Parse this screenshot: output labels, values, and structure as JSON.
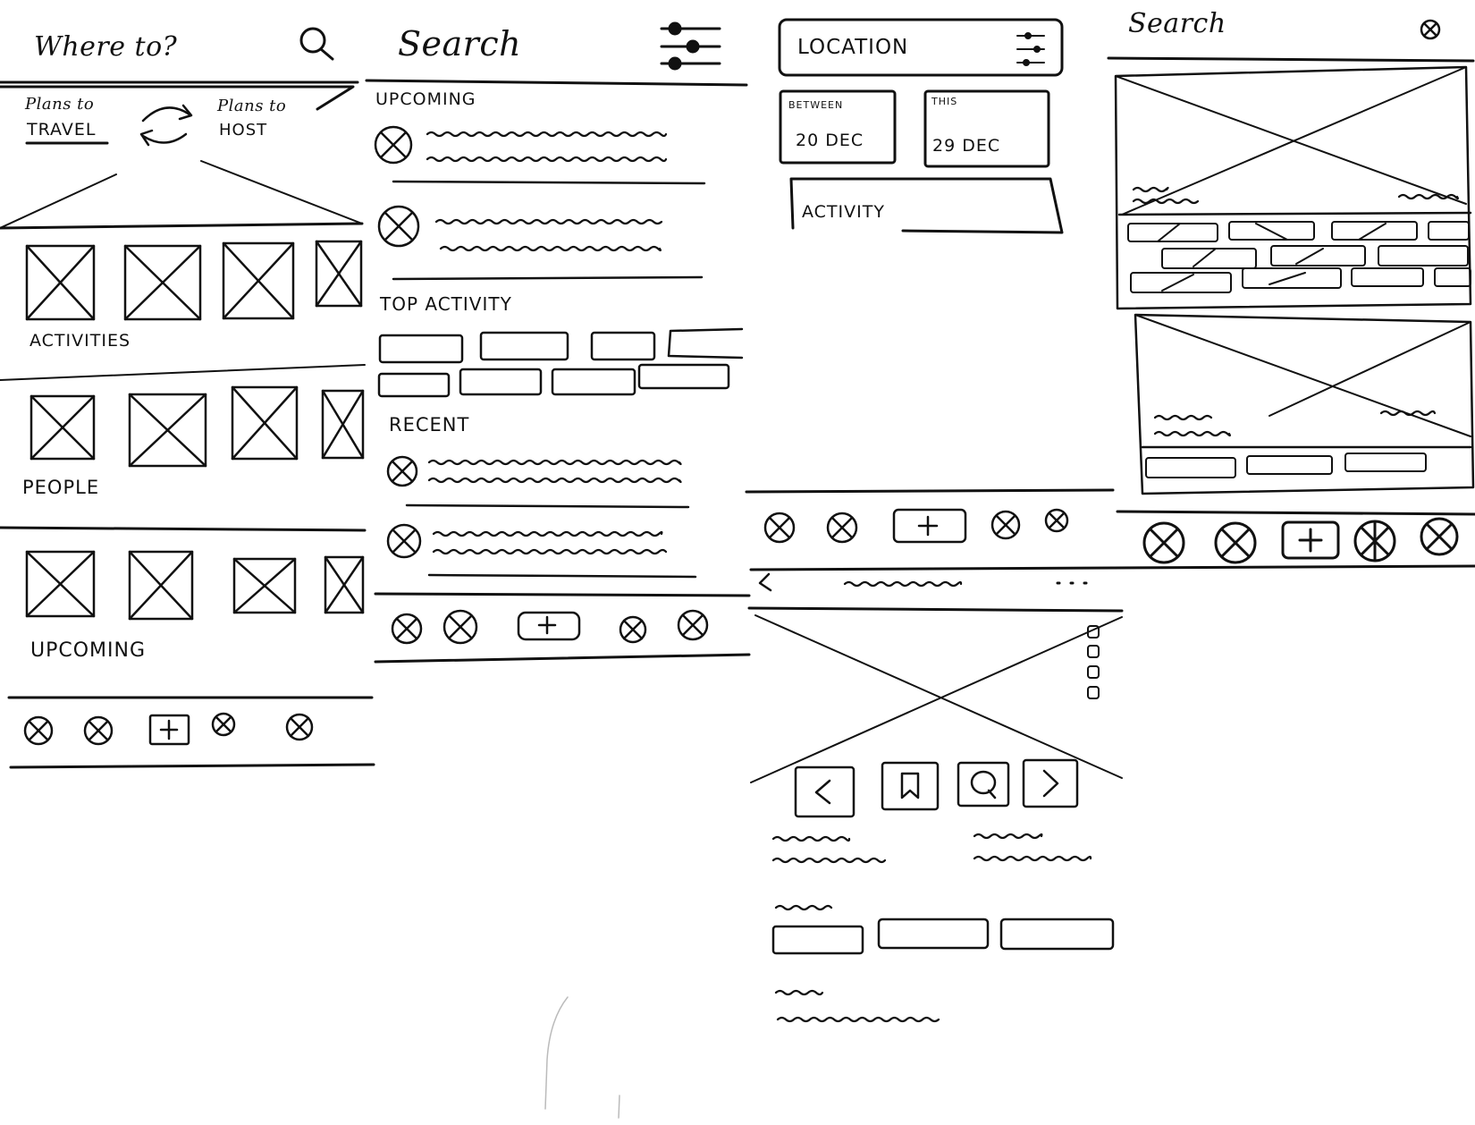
{
  "screens": [
    {
      "id": "home",
      "header": {
        "title": "Where to?",
        "search_icon": "search-icon"
      },
      "toggle": {
        "left": "Plans to",
        "left_emph": "TRAVEL",
        "right": "Plans to",
        "right_emph": "HOST",
        "icon": "swap-arrows-icon"
      },
      "sections": [
        "ACTIVITIES",
        "PEOPLE",
        "UPCOMING"
      ],
      "nav": [
        "nav-icon",
        "nav-icon",
        "add-icon",
        "nav-icon",
        "nav-icon"
      ]
    },
    {
      "id": "search",
      "header": {
        "title": "Search",
        "filter_icon": "filter-sliders-icon"
      },
      "sections": [
        "UPCOMING",
        "TOP ACTIVITY",
        "RECENT"
      ],
      "nav": [
        "nav-icon",
        "nav-icon",
        "add-icon",
        "nav-icon",
        "nav-icon"
      ]
    },
    {
      "id": "filter",
      "location_label": "LOCATION",
      "date_from": {
        "label": "BETWEEN",
        "value": "20 DEC"
      },
      "date_to": {
        "label": "THIS",
        "value": "29 DEC"
      },
      "activity_label": "ACTIVITY",
      "nav": [
        "nav-icon",
        "nav-icon",
        "add-icon",
        "nav-icon",
        "nav-icon"
      ]
    },
    {
      "id": "results",
      "header": {
        "title": "Search",
        "close_icon": "close-icon"
      },
      "nav": [
        "nav-icon",
        "nav-icon",
        "add-icon",
        "nav-icon",
        "nav-icon"
      ]
    },
    {
      "id": "detail",
      "header": {
        "back_icon": "back-icon",
        "more_icon": "more-icon"
      },
      "actions": [
        "previous-icon",
        "bookmark-icon",
        "comment-icon",
        "next-icon"
      ]
    }
  ]
}
